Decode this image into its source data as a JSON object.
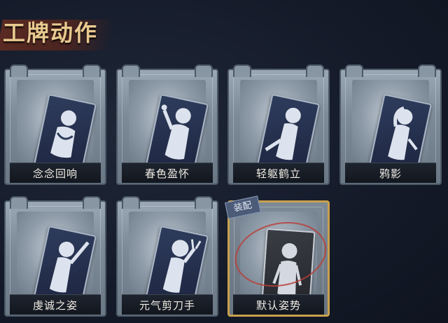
{
  "header": {
    "title": "工牌动作"
  },
  "cards": [
    {
      "label": "念念回响",
      "equipped": false
    },
    {
      "label": "春色盈怀",
      "equipped": false
    },
    {
      "label": "轻躯鹤立",
      "equipped": false
    },
    {
      "label": "鸦影",
      "equipped": false
    },
    {
      "label": "虔诚之姿",
      "equipped": false
    },
    {
      "label": "元气剪刀手",
      "equipped": false
    },
    {
      "label": "默认姿势",
      "equipped": true,
      "badge": "装配"
    }
  ],
  "colors": {
    "accent_gold": "#c9a04e",
    "title_gold": "#e9c98f",
    "ring_red": "#b8403a"
  }
}
